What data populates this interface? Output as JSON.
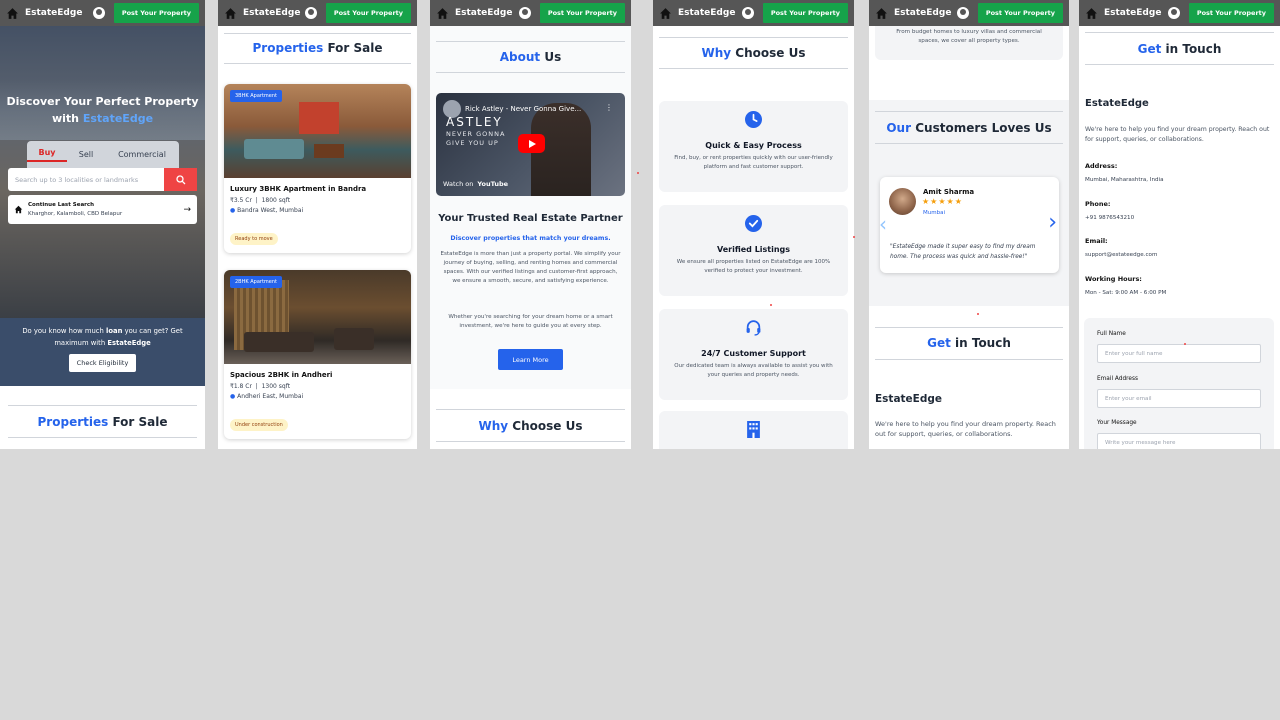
{
  "brand": "EstateEdge",
  "post_button": "Post Your Property",
  "hero": {
    "title_line1": "Discover Your Perfect Property",
    "title_with": "with",
    "title_brand": "EstateEdge",
    "tabs": [
      "Buy",
      "Sell",
      "Commercial"
    ],
    "search_placeholder": "Search up to 3 localities or landmarks",
    "last_search_title": "Continue Last Search",
    "last_search_value": "Kharghor, Kalamboli, CBD Belapur"
  },
  "loan": {
    "text_pre": "Do you know how much",
    "text_bold": "loan",
    "text_post": "you can get? Get maximum with",
    "brand": "EstateEdge",
    "button": "Check Eligibility"
  },
  "properties_title": {
    "blue": "Properties",
    "rest": "For Sale"
  },
  "listings": [
    {
      "badge": "3BHK Apartment",
      "title": "Luxury 3BHK Apartment in Bandra",
      "price": "₹3.5 Cr",
      "area": "1800 sqft",
      "location": "Bandra West, Mumbai",
      "status": "Ready to move"
    },
    {
      "badge": "2BHK Apartment",
      "title": "Spacious 2BHK in Andheri",
      "price": "₹1.8 Cr",
      "area": "1300 sqft",
      "location": "Andheri East, Mumbai",
      "status": "Under construction"
    }
  ],
  "about": {
    "title_blue": "About",
    "title_rest": "Us",
    "video_title": "Rick Astley - Never Gonna Give...",
    "video_overlay_1": "ASTLEY",
    "video_overlay_2": "NEVER GONNA",
    "video_overlay_3": "GIVE YOU UP",
    "watch_on": "Watch on",
    "youtube": "YouTube",
    "heading": "Your Trusted Real Estate Partner",
    "subheading": "Discover properties that match your dreams.",
    "para1": "EstateEdge is more than just a property portal. We simplify your journey of buying, selling, and renting homes and commercial spaces. With our verified listings and customer-first approach, we ensure a smooth, secure, and satisfying experience.",
    "para2": "Whether you're searching for your dream home or a smart investment, we're here to guide you at every step.",
    "button": "Learn More"
  },
  "why": {
    "title_blue": "Why",
    "title_rest": "Choose Us",
    "features": [
      {
        "icon": "clock-icon",
        "title": "Quick & Easy Process",
        "desc": "Find, buy, or rent properties quickly with our user-friendly platform and fast customer support."
      },
      {
        "icon": "check-circle-icon",
        "title": "Verified Listings",
        "desc": "We ensure all properties listed on EstateEdge are 100% verified to protect your investment."
      },
      {
        "icon": "headset-icon",
        "title": "24/7 Customer Support",
        "desc": "Our dedicated team is always available to assist you with your queries and property needs."
      }
    ]
  },
  "range_text": "From budget homes to luxury villas and commercial spaces, we cover all property types.",
  "customers": {
    "title_blue": "Our",
    "title_rest": "Customers Loves Us",
    "name": "Amit Sharma",
    "stars": "★★★★★",
    "city": "Mumbai",
    "quote": "\"EstateEdge made it super easy to find my dream home. The process was quick and hassle-free!\""
  },
  "contact": {
    "title_blue": "Get",
    "title_rest": "in Touch",
    "brand": "EstateEdge",
    "intro": "We're here to help you find your dream property. Reach out for support, queries, or collaborations.",
    "address_label": "Address:",
    "address": "Mumbai, Maharashtra, India",
    "phone_label": "Phone:",
    "phone": "+91 9876543210",
    "email_label": "Email:",
    "email": "support@estateedge.com",
    "hours_label": "Working Hours:",
    "hours": "Mon - Sat: 9:00 AM - 6:00 PM",
    "form": {
      "name_label": "Full Name",
      "name_ph": "Enter your full name",
      "email_label": "Email Address",
      "email_ph": "Enter your email",
      "msg_label": "Your Message",
      "msg_ph": "Write your message here"
    }
  }
}
